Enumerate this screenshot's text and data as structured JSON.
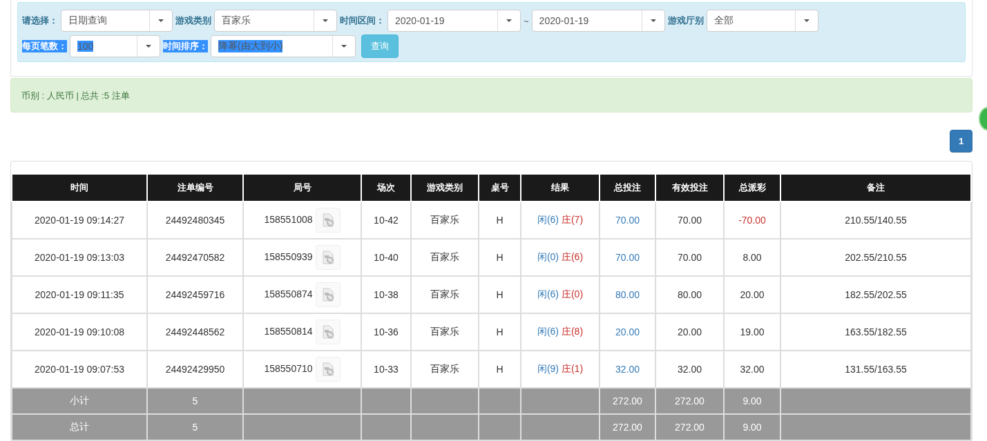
{
  "filters": {
    "rows": [
      [
        {
          "kind": "select",
          "label": "请选择：",
          "value": "日期查询",
          "highlighted": false
        },
        {
          "kind": "select",
          "label": "游戏类别",
          "value": "百家乐",
          "highlighted": false
        },
        {
          "kind": "date_range",
          "label": "时间区间：",
          "from": "2020-01-19",
          "separator": "~",
          "to": "2020-01-19",
          "highlighted": false
        },
        {
          "kind": "select",
          "label": "游戏厅别",
          "value": "全部",
          "highlighted": false
        }
      ],
      [
        {
          "kind": "select",
          "label": "每页笔数：",
          "value": "100",
          "highlighted": true
        },
        {
          "kind": "select",
          "label": "时间排序：",
          "value": "降幂(由大到小)",
          "highlighted": true
        }
      ]
    ],
    "button": "查询"
  },
  "summary": "币别 : 人民币 | 总共 :5 注单",
  "pagination": [
    {
      "label": "1",
      "selected": true
    }
  ],
  "table": {
    "columns": [
      "时间",
      "注单编号",
      "局号",
      "场次",
      "游戏类别",
      "桌号",
      "结果",
      "总投注",
      "有效投注",
      "总派彩",
      "备注"
    ],
    "rows": [
      {
        "time": "2020-01-19 09:14:27",
        "bet_id": "24492480345",
        "round": "158551008",
        "session": "10-42",
        "game": "百家乐",
        "table": "H",
        "player": "闲(6)",
        "banker": "庄(7)",
        "total_bet": "70.00",
        "valid_bet": "70.00",
        "payout": "-70.00",
        "loss": true,
        "remark": "210.55/140.55"
      },
      {
        "time": "2020-01-19 09:13:03",
        "bet_id": "24492470582",
        "round": "158550939",
        "session": "10-40",
        "game": "百家乐",
        "table": "H",
        "player": "闲(0)",
        "banker": "庄(6)",
        "total_bet": "70.00",
        "valid_bet": "70.00",
        "payout": "8.00",
        "loss": false,
        "remark": "202.55/210.55"
      },
      {
        "time": "2020-01-19 09:11:35",
        "bet_id": "24492459716",
        "round": "158550874",
        "session": "10-38",
        "game": "百家乐",
        "table": "H",
        "player": "闲(6)",
        "banker": "庄(0)",
        "total_bet": "80.00",
        "valid_bet": "80.00",
        "payout": "20.00",
        "loss": false,
        "remark": "182.55/202.55"
      },
      {
        "time": "2020-01-19 09:10:08",
        "bet_id": "24492448562",
        "round": "158550814",
        "session": "10-36",
        "game": "百家乐",
        "table": "H",
        "player": "闲(6)",
        "banker": "庄(8)",
        "total_bet": "20.00",
        "valid_bet": "20.00",
        "payout": "19.00",
        "loss": false,
        "remark": "163.55/182.55"
      },
      {
        "time": "2020-01-19 09:07:53",
        "bet_id": "24492429950",
        "round": "158550710",
        "session": "10-33",
        "game": "百家乐",
        "table": "H",
        "player": "闲(9)",
        "banker": "庄(1)",
        "total_bet": "32.00",
        "valid_bet": "32.00",
        "payout": "32.00",
        "loss": false,
        "remark": "131.55/163.55"
      }
    ],
    "totals": [
      {
        "label": "小计",
        "count": "5",
        "total_bet": "272.00",
        "valid_bet": "272.00",
        "payout": "9.00"
      },
      {
        "label": "总计",
        "count": "5",
        "total_bet": "272.00",
        "valid_bet": "272.00",
        "payout": "9.00"
      }
    ]
  }
}
